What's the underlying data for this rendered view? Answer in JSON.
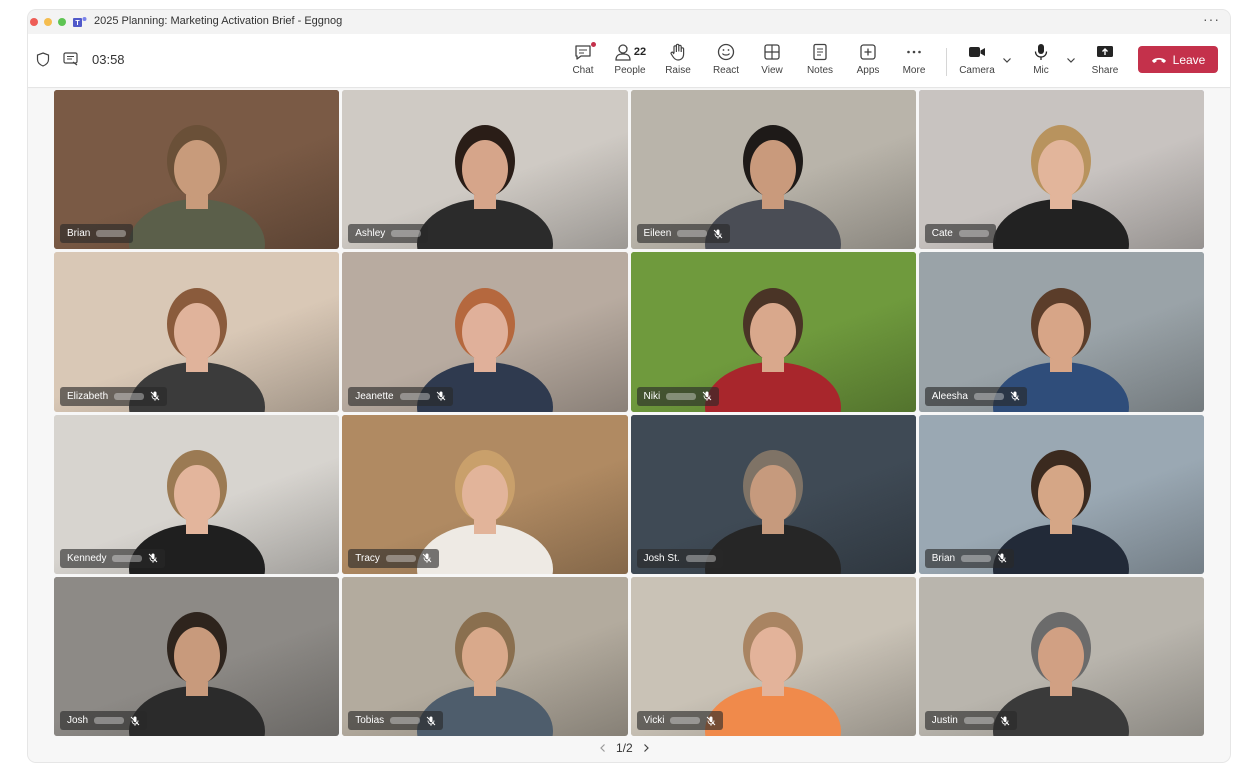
{
  "window": {
    "title": "2025 Planning: Marketing Activation Brief - Eggnog"
  },
  "toolbar": {
    "timer": "03:58",
    "buttons": {
      "chat": "Chat",
      "people": "People",
      "people_count": "22",
      "raise": "Raise",
      "react": "React",
      "view": "View",
      "notes": "Notes",
      "apps": "Apps",
      "more": "More",
      "camera": "Camera",
      "mic": "Mic",
      "share": "Share",
      "leave": "Leave"
    }
  },
  "participants": [
    {
      "name": "Brian",
      "muted": false,
      "active": false,
      "bg": "#7a5a45",
      "shirt": "#5b5f4a",
      "skin": "#c89b7b",
      "hair": "#6a5038"
    },
    {
      "name": "Ashley",
      "muted": false,
      "active": false,
      "bg": "#cfcac4",
      "shirt": "#2b2b2b",
      "skin": "#d6a58a",
      "hair": "#2a1d17"
    },
    {
      "name": "Eileen",
      "muted": true,
      "active": false,
      "bg": "#b9b4aa",
      "shirt": "#4a4d55",
      "skin": "#c99a7c",
      "hair": "#1e1a18"
    },
    {
      "name": "Cate",
      "muted": false,
      "active": true,
      "bg": "#c8c3c0",
      "shirt": "#222222",
      "skin": "#e2b59b",
      "hair": "#b8935e"
    },
    {
      "name": "Elizabeth",
      "muted": true,
      "active": false,
      "bg": "#d9c8b6",
      "shirt": "#3b3b3b",
      "skin": "#e0b39b",
      "hair": "#8a5b3c"
    },
    {
      "name": "Jeanette",
      "muted": true,
      "active": false,
      "bg": "#b8aba0",
      "shirt": "#2f3a4f",
      "skin": "#e0b09a",
      "hair": "#b5683e"
    },
    {
      "name": "Niki",
      "muted": true,
      "active": false,
      "bg": "#6f9a3d",
      "shirt": "#a8262c",
      "skin": "#d9a88c",
      "hair": "#4a3426"
    },
    {
      "name": "Aleesha",
      "muted": true,
      "active": false,
      "bg": "#9aa3a8",
      "shirt": "#2f4d7a",
      "skin": "#d7a587",
      "hair": "#5b3d2a"
    },
    {
      "name": "Kennedy",
      "muted": true,
      "active": false,
      "bg": "#d7d4cf",
      "shirt": "#1f1f1f",
      "skin": "#e3b59c",
      "hair": "#9b7a53"
    },
    {
      "name": "Tracy",
      "muted": true,
      "active": false,
      "bg": "#b08a62",
      "shirt": "#eeeae4",
      "skin": "#e2b49a",
      "hair": "#c9a06b"
    },
    {
      "name": "Josh St.",
      "muted": false,
      "active": false,
      "bg": "#3f4a55",
      "shirt": "#262626",
      "skin": "#c69a7d",
      "hair": "#7f7366"
    },
    {
      "name": "Brian",
      "muted": true,
      "active": false,
      "bg": "#9aa8b3",
      "shirt": "#222a38",
      "skin": "#d5a686",
      "hair": "#3b2a1f"
    },
    {
      "name": "Josh",
      "muted": true,
      "active": false,
      "bg": "#8d8a86",
      "shirt": "#2b2b2b",
      "skin": "#c89a7c",
      "hair": "#2e241d"
    },
    {
      "name": "Tobias",
      "muted": true,
      "active": false,
      "bg": "#b3ab9e",
      "shirt": "#4e5d6c",
      "skin": "#d9a98b",
      "hair": "#8a6f4f"
    },
    {
      "name": "Vicki",
      "muted": true,
      "active": false,
      "bg": "#c9c2b6",
      "shirt": "#f08a4b",
      "skin": "#e3b39a",
      "hair": "#a98462"
    },
    {
      "name": "Justin",
      "muted": true,
      "active": false,
      "bg": "#b9b5ad",
      "shirt": "#3a3a3a",
      "skin": "#d1a083",
      "hair": "#6b6b6b"
    }
  ],
  "pager": {
    "label": "1/2"
  }
}
